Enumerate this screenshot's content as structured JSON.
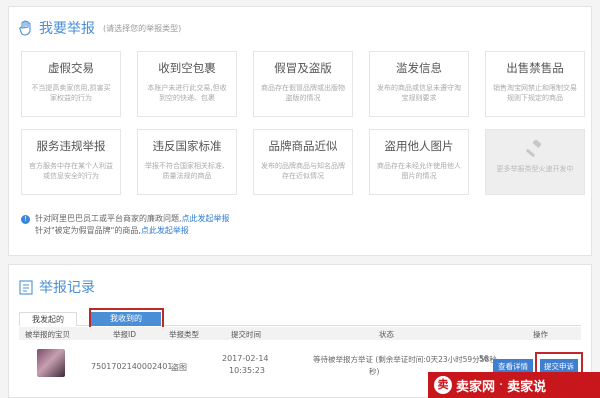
{
  "report_section": {
    "title": "我要举报",
    "hint": "(请选择您的举报类型)",
    "tiles": [
      {
        "title": "虚假交易",
        "desc": "不当提高卖家信用,损害买家权益的行为"
      },
      {
        "title": "收到空包裹",
        "desc": "本账户未进行此交易,但收到空的快递、包裹"
      },
      {
        "title": "假冒及盗版",
        "desc": "商品存在假冒品牌或出版物盗版的情况"
      },
      {
        "title": "滥发信息",
        "desc": "发布的商品或信息未遵守淘宝规则要求"
      },
      {
        "title": "出售禁售品",
        "desc": "销售淘宝网禁止和限制交易规则下规定的商品"
      },
      {
        "title": "服务违规举报",
        "desc": "官方服务中存在某个人利益或信息安全的行为"
      },
      {
        "title": "违反国家标准",
        "desc": "举报不符合国家相关标准、质量法规的商品"
      },
      {
        "title": "品牌商品近似",
        "desc": "发布的品牌商品与知名品牌存在近似情况"
      },
      {
        "title": "盗用他人图片",
        "desc": "商品存在未经允许使用他人图片的情况"
      }
    ],
    "more_tile": {
      "desc": "更多举报类型火速开发中"
    }
  },
  "notes": {
    "note1_text": "针对阿里巴巴员工或平台商家的廉政问题,",
    "note1_link": "点此发起举报",
    "note2_text": "针对\"被定为假冒品牌\"的商品,",
    "note2_link": "点此发起举报"
  },
  "records": {
    "title": "举报记录",
    "tabs": {
      "sent": "我发起的",
      "received": "我收到的"
    },
    "columns": {
      "item": "被举报的宝贝",
      "report_id": "举报ID",
      "type": "举报类型",
      "submit_time": "提交时间",
      "status": "状态",
      "actions": "操作"
    },
    "rows": [
      {
        "report_id": "7501702140002401",
        "type": "盗图",
        "date": "2017-02-14",
        "time": "10:35:23",
        "status_line1": "等待被举报方举证 (剩余举证时间:0天23小时59分58秒",
        "status_line2": "56",
        "status_line3": "秒)",
        "view_label": "查看详情",
        "appeal_label": "提交申诉"
      }
    ]
  },
  "watermark": {
    "logo": "卖",
    "text1": "卖家网",
    "sep": "·",
    "text2": "卖家说"
  }
}
